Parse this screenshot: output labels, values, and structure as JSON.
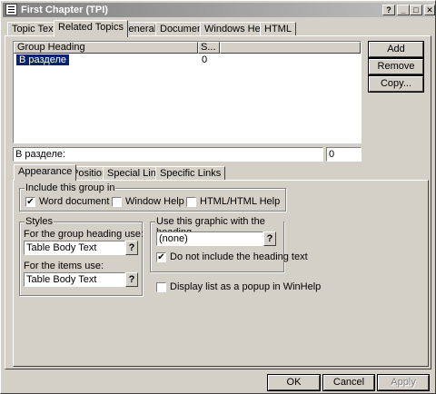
{
  "window": {
    "title": "First Chapter  (TPI)",
    "controls": {
      "help": "?",
      "minimize": "_",
      "maximize": "□",
      "close": "✕"
    }
  },
  "top_tabs": [
    {
      "label": "Topic Text"
    },
    {
      "label": "Related Topics"
    },
    {
      "label": "General"
    },
    {
      "label": "Document"
    },
    {
      "label": "Windows Help"
    },
    {
      "label": "HTML"
    }
  ],
  "groups_table": {
    "columns": [
      "Group Heading",
      "S..."
    ],
    "rows": [
      {
        "heading": "В разделе",
        "s": "0"
      }
    ]
  },
  "side_buttons": {
    "add": "Add",
    "remove": "Remove",
    "copy": "Copy..."
  },
  "heading_field": {
    "value": "В разделе:"
  },
  "number_field": {
    "value": "0"
  },
  "sub_tabs": [
    {
      "label": "Appearance"
    },
    {
      "label": "Position"
    },
    {
      "label": "Special Links"
    },
    {
      "label": "Specific Links"
    }
  ],
  "include_group": {
    "legend": "Include this group in",
    "word_document": {
      "label": "Word document",
      "checked": true,
      "mark": "✔"
    },
    "window_help": {
      "label": "Window Help",
      "checked": false
    },
    "html_help": {
      "label": "HTML/HTML Help",
      "checked": false
    }
  },
  "styles_group": {
    "legend": "Styles",
    "group_heading_label": "For the group heading use:",
    "group_heading_value": "Table Body Text",
    "items_label": "For the items use:",
    "items_value": "Table Body Text",
    "browse": "?"
  },
  "graphic_group": {
    "legend": "Use this graphic with the heading",
    "value": "(none)",
    "browse": "?",
    "no_heading_text": {
      "label": "Do not include the heading text",
      "checked": true,
      "mark": "✔"
    }
  },
  "popup_option": {
    "label": "Display list as a popup in WinHelp",
    "checked": false
  },
  "footer_buttons": {
    "ok": "OK",
    "cancel": "Cancel",
    "apply": "Apply"
  },
  "colors": {
    "selection": "#0a246a",
    "face": "#d4d0c8"
  }
}
